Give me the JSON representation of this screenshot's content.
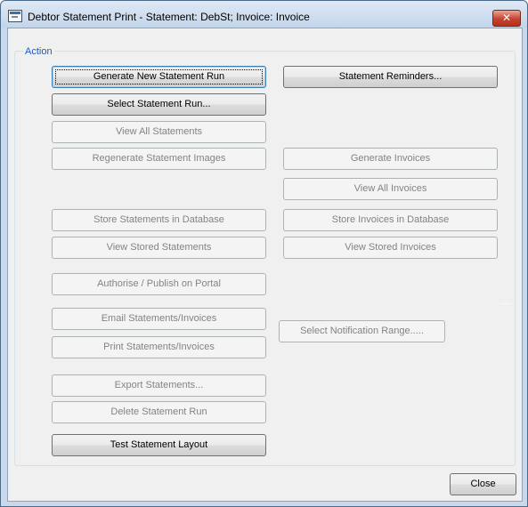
{
  "window": {
    "title": "Debtor Statement Print - Statement: DebSt;  Invoice: Invoice",
    "close_glyph": "✕"
  },
  "group": {
    "label": "Action"
  },
  "buttons": {
    "generate_new_statement_run": "Generate New Statement Run",
    "statement_reminders": "Statement Reminders...",
    "select_statement_run": "Select Statement Run...",
    "view_all_statements": "View All Statements",
    "regenerate_statement_images": "Regenerate Statement Images",
    "generate_invoices": "Generate Invoices",
    "view_all_invoices": "View All Invoices",
    "store_statements_in_database": "Store Statements in Database",
    "store_invoices_in_database": "Store Invoices in Database",
    "view_stored_statements": "View Stored Statements",
    "view_stored_invoices": "View Stored Invoices",
    "authorise_publish_on_portal": "Authorise / Publish on Portal",
    "email_statements_invoices": "Email Statements/Invoices",
    "select_notification_range": "Select Notification Range.....",
    "print_statements_invoices": "Print Statements/Invoices",
    "export_statements": "Export Statements...",
    "delete_statement_run": "Delete Statement Run",
    "test_statement_layout": "Test Statement Layout",
    "close": "Close"
  },
  "icons": {
    "app": "window-app-icon",
    "close": "close-icon"
  }
}
